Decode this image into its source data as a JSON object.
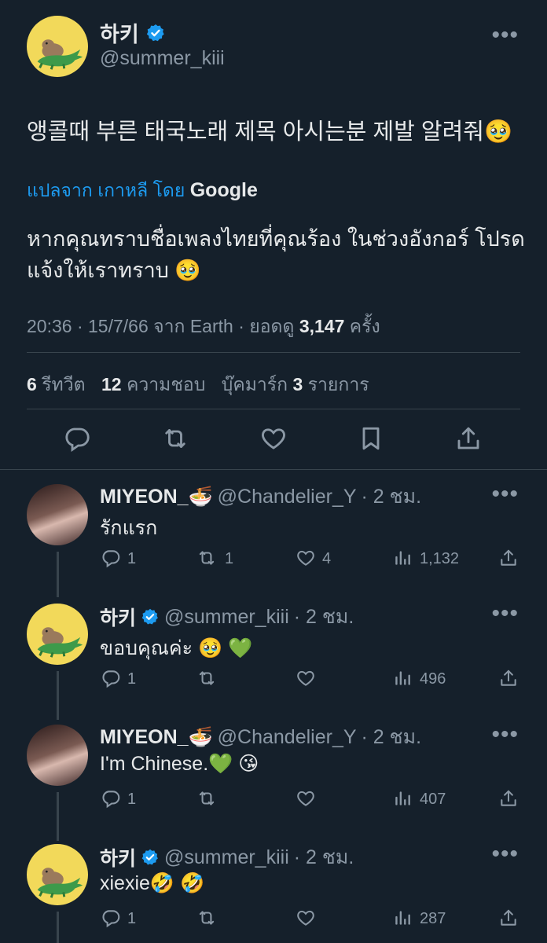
{
  "main_tweet": {
    "display_name": "하키",
    "handle": "@summer_kiii",
    "text": "앵콜때 부른 태국노래 제목 아시는분 제발 알려줘🥹",
    "translated_from": "แปลจาก เกาหลี โดย",
    "translator": "Google",
    "translation": "หากคุณทราบชื่อเพลงไทยที่คุณร้อง ในช่วงอังกอร์ โปรดแจ้งให้เราทราบ 🥹",
    "meta_prefix": "20:36 · 15/7/66 จาก Earth · ยอดดู",
    "views": "3,147",
    "views_suffix": "ครั้ง",
    "retweets": "6",
    "retweets_label": "รีทวีต",
    "likes": "12",
    "likes_label": "ความชอบ",
    "bookmarks_label": "บุ๊คมาร์ก",
    "bookmarks": "3",
    "bookmarks_suffix": "รายการ",
    "more": "•••"
  },
  "replies": [
    {
      "name": "MIYEON_🍜",
      "handle": "@Chandelier_Y",
      "time": "· 2 ชม.",
      "text": "รักแรก",
      "replies": "1",
      "retweets": "1",
      "likes": "4",
      "views": "1,132",
      "more": "•••"
    },
    {
      "name": "하키",
      "handle": "@summer_kiii",
      "time": "· 2 ชม.",
      "text": "ขอบคุณค่ะ 🥹 💚",
      "replies": "1",
      "retweets": "",
      "likes": "",
      "views": "496",
      "more": "•••"
    },
    {
      "name": "MIYEON_🍜",
      "handle": "@Chandelier_Y",
      "time": "· 2 ชม.",
      "text": "I'm Chinese.💚 😘",
      "replies": "1",
      "retweets": "",
      "likes": "",
      "views": "407",
      "more": "•••"
    },
    {
      "name": "하키",
      "handle": "@summer_kiii",
      "time": "· 2 ชม.",
      "text": "xiexie🤣 🤣",
      "replies": "1",
      "retweets": "",
      "likes": "",
      "views": "287",
      "more": "•••"
    }
  ],
  "colors": {
    "background": "#15202b",
    "text": "#e7e9ea",
    "muted": "#8b98a5",
    "accent": "#1d9bf0",
    "divider": "#38444d"
  },
  "icons": [
    "reply-icon",
    "retweet-icon",
    "like-icon",
    "bookmark-icon",
    "share-icon",
    "views-icon",
    "verified-icon",
    "more-icon"
  ]
}
